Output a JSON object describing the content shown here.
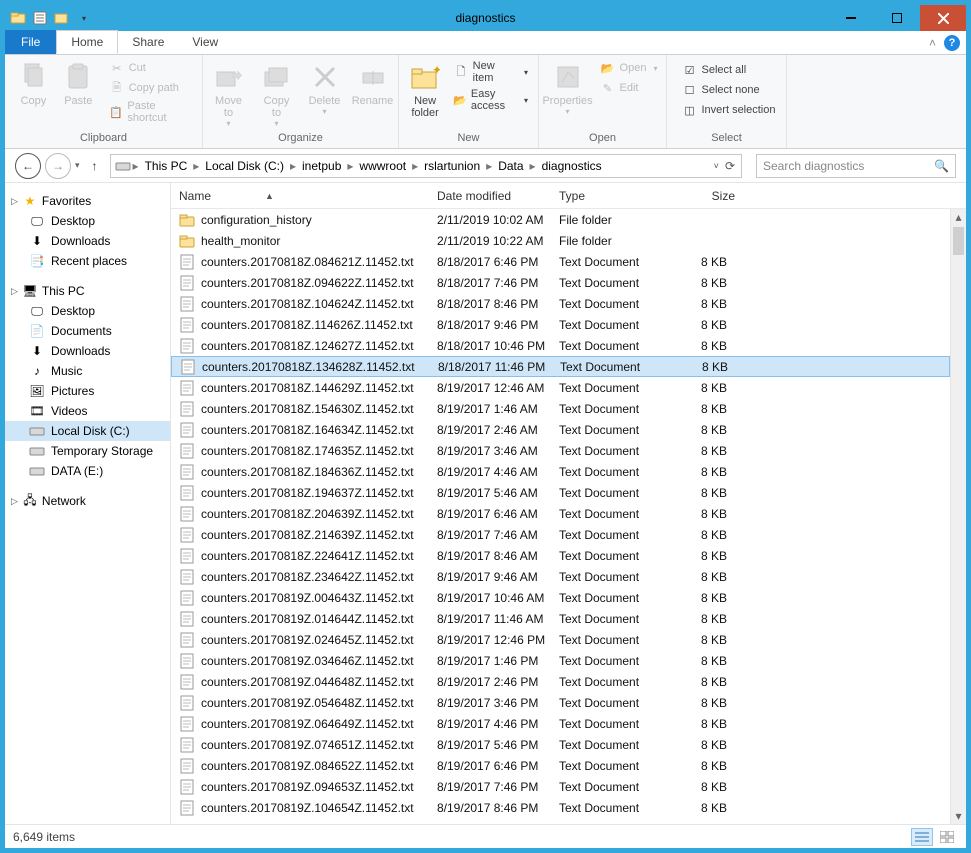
{
  "window": {
    "title": "diagnostics"
  },
  "ribbon": {
    "file": "File",
    "tabs": [
      {
        "label": "Home",
        "active": true
      },
      {
        "label": "Share",
        "active": false
      },
      {
        "label": "View",
        "active": false
      }
    ],
    "clipboard": {
      "group": "Clipboard",
      "copy": "Copy",
      "paste": "Paste",
      "cut": "Cut",
      "copy_path": "Copy path",
      "paste_shortcut": "Paste shortcut"
    },
    "organize": {
      "group": "Organize",
      "moveto": "Move\nto",
      "copyto": "Copy\nto",
      "delete": "Delete",
      "rename": "Rename"
    },
    "new_grp": {
      "group": "New",
      "new_folder": "New\nfolder",
      "new_item": "New item",
      "easy_access": "Easy access"
    },
    "open_grp": {
      "group": "Open",
      "properties": "Properties",
      "open": "Open",
      "edit": "Edit"
    },
    "select_grp": {
      "group": "Select",
      "select_all": "Select all",
      "select_none": "Select none",
      "invert": "Invert selection"
    }
  },
  "nav": {
    "breadcrumb": [
      "This PC",
      "Local Disk (C:)",
      "inetpub",
      "wwwroot",
      "rslartunion",
      "Data",
      "diagnostics"
    ]
  },
  "search": {
    "placeholder": "Search diagnostics"
  },
  "sidebar": {
    "favorites": {
      "label": "Favorites",
      "items": [
        "Desktop",
        "Downloads",
        "Recent places"
      ]
    },
    "thispc": {
      "label": "This PC",
      "items": [
        "Desktop",
        "Documents",
        "Downloads",
        "Music",
        "Pictures",
        "Videos",
        "Local Disk (C:)",
        "Temporary Storage",
        "DATA (E:)"
      ],
      "selected": "Local Disk (C:)"
    },
    "network": {
      "label": "Network"
    }
  },
  "columns": {
    "name": "Name",
    "date": "Date modified",
    "type": "Type",
    "size": "Size"
  },
  "files": {
    "selected_index": 7,
    "rows": [
      {
        "icon": "folder",
        "name": "configuration_history",
        "date": "2/11/2019 10:02 AM",
        "type": "File folder",
        "size": ""
      },
      {
        "icon": "folder",
        "name": "health_monitor",
        "date": "2/11/2019 10:22 AM",
        "type": "File folder",
        "size": ""
      },
      {
        "icon": "txt",
        "name": "counters.20170818Z.084621Z.11452.txt",
        "date": "8/18/2017 6:46 PM",
        "type": "Text Document",
        "size": "8 KB"
      },
      {
        "icon": "txt",
        "name": "counters.20170818Z.094622Z.11452.txt",
        "date": "8/18/2017 7:46 PM",
        "type": "Text Document",
        "size": "8 KB"
      },
      {
        "icon": "txt",
        "name": "counters.20170818Z.104624Z.11452.txt",
        "date": "8/18/2017 8:46 PM",
        "type": "Text Document",
        "size": "8 KB"
      },
      {
        "icon": "txt",
        "name": "counters.20170818Z.114626Z.11452.txt",
        "date": "8/18/2017 9:46 PM",
        "type": "Text Document",
        "size": "8 KB"
      },
      {
        "icon": "txt",
        "name": "counters.20170818Z.124627Z.11452.txt",
        "date": "8/18/2017 10:46 PM",
        "type": "Text Document",
        "size": "8 KB"
      },
      {
        "icon": "txt",
        "name": "counters.20170818Z.134628Z.11452.txt",
        "date": "8/18/2017 11:46 PM",
        "type": "Text Document",
        "size": "8 KB"
      },
      {
        "icon": "txt",
        "name": "counters.20170818Z.144629Z.11452.txt",
        "date": "8/19/2017 12:46 AM",
        "type": "Text Document",
        "size": "8 KB"
      },
      {
        "icon": "txt",
        "name": "counters.20170818Z.154630Z.11452.txt",
        "date": "8/19/2017 1:46 AM",
        "type": "Text Document",
        "size": "8 KB"
      },
      {
        "icon": "txt",
        "name": "counters.20170818Z.164634Z.11452.txt",
        "date": "8/19/2017 2:46 AM",
        "type": "Text Document",
        "size": "8 KB"
      },
      {
        "icon": "txt",
        "name": "counters.20170818Z.174635Z.11452.txt",
        "date": "8/19/2017 3:46 AM",
        "type": "Text Document",
        "size": "8 KB"
      },
      {
        "icon": "txt",
        "name": "counters.20170818Z.184636Z.11452.txt",
        "date": "8/19/2017 4:46 AM",
        "type": "Text Document",
        "size": "8 KB"
      },
      {
        "icon": "txt",
        "name": "counters.20170818Z.194637Z.11452.txt",
        "date": "8/19/2017 5:46 AM",
        "type": "Text Document",
        "size": "8 KB"
      },
      {
        "icon": "txt",
        "name": "counters.20170818Z.204639Z.11452.txt",
        "date": "8/19/2017 6:46 AM",
        "type": "Text Document",
        "size": "8 KB"
      },
      {
        "icon": "txt",
        "name": "counters.20170818Z.214639Z.11452.txt",
        "date": "8/19/2017 7:46 AM",
        "type": "Text Document",
        "size": "8 KB"
      },
      {
        "icon": "txt",
        "name": "counters.20170818Z.224641Z.11452.txt",
        "date": "8/19/2017 8:46 AM",
        "type": "Text Document",
        "size": "8 KB"
      },
      {
        "icon": "txt",
        "name": "counters.20170818Z.234642Z.11452.txt",
        "date": "8/19/2017 9:46 AM",
        "type": "Text Document",
        "size": "8 KB"
      },
      {
        "icon": "txt",
        "name": "counters.20170819Z.004643Z.11452.txt",
        "date": "8/19/2017 10:46 AM",
        "type": "Text Document",
        "size": "8 KB"
      },
      {
        "icon": "txt",
        "name": "counters.20170819Z.014644Z.11452.txt",
        "date": "8/19/2017 11:46 AM",
        "type": "Text Document",
        "size": "8 KB"
      },
      {
        "icon": "txt",
        "name": "counters.20170819Z.024645Z.11452.txt",
        "date": "8/19/2017 12:46 PM",
        "type": "Text Document",
        "size": "8 KB"
      },
      {
        "icon": "txt",
        "name": "counters.20170819Z.034646Z.11452.txt",
        "date": "8/19/2017 1:46 PM",
        "type": "Text Document",
        "size": "8 KB"
      },
      {
        "icon": "txt",
        "name": "counters.20170819Z.044648Z.11452.txt",
        "date": "8/19/2017 2:46 PM",
        "type": "Text Document",
        "size": "8 KB"
      },
      {
        "icon": "txt",
        "name": "counters.20170819Z.054648Z.11452.txt",
        "date": "8/19/2017 3:46 PM",
        "type": "Text Document",
        "size": "8 KB"
      },
      {
        "icon": "txt",
        "name": "counters.20170819Z.064649Z.11452.txt",
        "date": "8/19/2017 4:46 PM",
        "type": "Text Document",
        "size": "8 KB"
      },
      {
        "icon": "txt",
        "name": "counters.20170819Z.074651Z.11452.txt",
        "date": "8/19/2017 5:46 PM",
        "type": "Text Document",
        "size": "8 KB"
      },
      {
        "icon": "txt",
        "name": "counters.20170819Z.084652Z.11452.txt",
        "date": "8/19/2017 6:46 PM",
        "type": "Text Document",
        "size": "8 KB"
      },
      {
        "icon": "txt",
        "name": "counters.20170819Z.094653Z.11452.txt",
        "date": "8/19/2017 7:46 PM",
        "type": "Text Document",
        "size": "8 KB"
      },
      {
        "icon": "txt",
        "name": "counters.20170819Z.104654Z.11452.txt",
        "date": "8/19/2017 8:46 PM",
        "type": "Text Document",
        "size": "8 KB"
      }
    ]
  },
  "status": {
    "items": "6,649 items"
  }
}
